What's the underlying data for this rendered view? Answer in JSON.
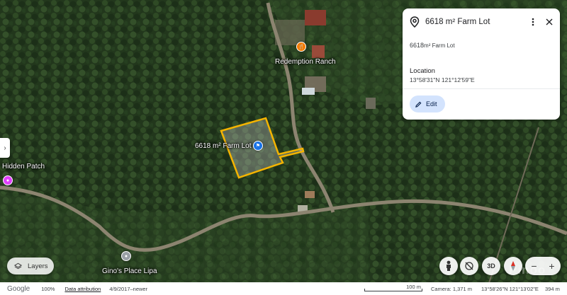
{
  "map": {
    "places": {
      "redemption_ranch": "Redemption Ranch",
      "farm_lot": "6618 m² Farm Lot",
      "hidden_patch": "Hidden Patch",
      "ginos_place": "Gino's Place Lipa"
    },
    "colors": {
      "polygon_stroke": "#f4b400",
      "ranch_pin": "#f57c00",
      "hidden_patch_pin": "#e040fb",
      "farm_pin": "#1a73e8"
    }
  },
  "panel": {
    "title": "6618 m² Farm Lot",
    "description_number": "6618",
    "description_unit": "m²",
    "description_rest": " Farm Lot",
    "location_heading": "Location",
    "location_value": "13°58'31\"N 121°12'59\"E",
    "edit_label": "Edit",
    "icons": [
      "location-pin-icon",
      "more-vert-icon",
      "close-icon",
      "pencil-icon"
    ]
  },
  "controls": {
    "layers_label": "Layers",
    "three_d_label": "3D",
    "zoom_out": "−",
    "zoom_in": "+"
  },
  "footer": {
    "brand": "Google",
    "zoom": "100%",
    "attribution": "Data attribution",
    "imagery_date": "4/9/2017–newer",
    "scale_label": "100 m",
    "camera": "Camera: 1,371 m",
    "coordinates": "13°58'26\"N 121°13'02\"E",
    "altitude": "394 m"
  },
  "watermark": "Pinoo"
}
